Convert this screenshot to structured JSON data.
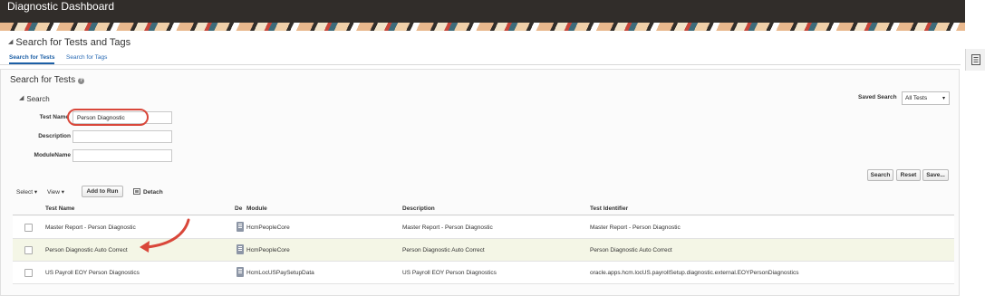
{
  "app": {
    "title": "Diagnostic Dashboard"
  },
  "page": {
    "heading": "Search for Tests and Tags"
  },
  "tabs": [
    {
      "label": "Search for Tests",
      "active": true
    },
    {
      "label": "Search for Tags",
      "active": false
    }
  ],
  "panel": {
    "title": "Search for Tests",
    "help_icon": "?",
    "search_section": "Search",
    "saved_search": {
      "label": "Saved Search",
      "value": "All Tests"
    }
  },
  "fields": {
    "test_name": {
      "label": "Test Name",
      "value": "Person Diagnostic"
    },
    "description": {
      "label": "Description",
      "value": ""
    },
    "module_name": {
      "label": "ModuleName",
      "value": ""
    }
  },
  "actions": {
    "search": "Search",
    "reset": "Reset",
    "save": "Save..."
  },
  "toolbar": {
    "select": "Select",
    "view": "View",
    "add_to_run": "Add to Run",
    "detach": "Detach"
  },
  "table": {
    "headers": [
      "Test Name",
      "De",
      "Module",
      "Description",
      "Test Identifier"
    ],
    "rows": [
      {
        "name": "Master Report - Person Diagnostic",
        "module": "HcmPeopleCore",
        "description": "Master Report - Person Diagnostic",
        "identifier": "Master Report - Person Diagnostic",
        "selected": false
      },
      {
        "name": "Person Diagnostic Auto Correct",
        "module": "HcmPeopleCore",
        "description": "Person Diagnostic Auto Correct",
        "identifier": "Person Diagnostic Auto Correct",
        "selected": true
      },
      {
        "name": "US Payroll EOY Person Diagnostics",
        "module": "HcmLocUSPaySetupData",
        "description": "US Payroll EOY Person Diagnostics",
        "identifier": "oracle.apps.hcm.locUS.payrollSetup.diagnostic.external.EOYPersonDiagnostics",
        "selected": false
      }
    ]
  },
  "icons": {
    "side_panel": "document-list-icon",
    "module": "module-icon",
    "detach": "detach-icon"
  },
  "colors": {
    "header_bg": "#312d2a",
    "link": "#2a6bb5",
    "annotation": "#d9473a",
    "selected_row": "#f4f6e6"
  }
}
